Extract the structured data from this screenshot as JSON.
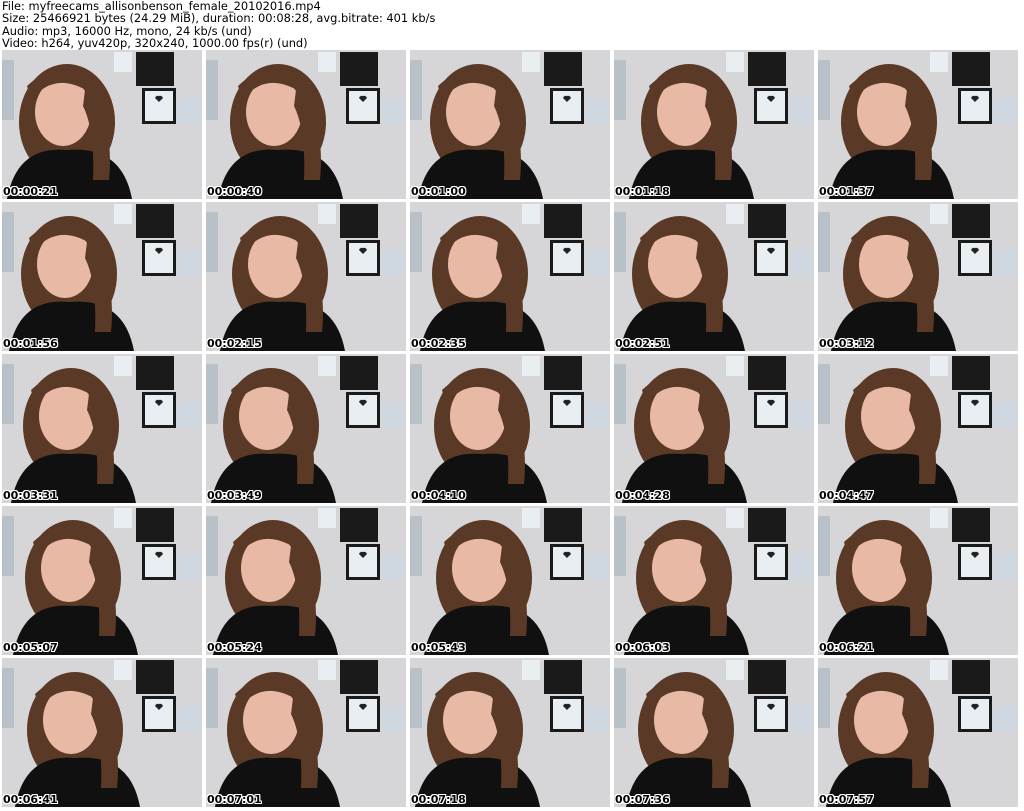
{
  "header": {
    "file_line": "File: myfreecams_allisonbenson_female_20102016.mp4",
    "size_line": "Size: 25466921 bytes (24.29 MiB), duration: 00:08:28, avg.bitrate: 401 kb/s",
    "audio_line": "Audio: mp3, 16000 Hz, mono, 24 kb/s (und)",
    "video_line": "Video: h264, yuv420p, 320x240, 1000.00 fps(r) (und)"
  },
  "thumbnails": [
    {
      "timestamp": "00:00:21"
    },
    {
      "timestamp": "00:00:40"
    },
    {
      "timestamp": "00:01:00"
    },
    {
      "timestamp": "00:01:18"
    },
    {
      "timestamp": "00:01:37"
    },
    {
      "timestamp": "00:01:56"
    },
    {
      "timestamp": "00:02:15"
    },
    {
      "timestamp": "00:02:35"
    },
    {
      "timestamp": "00:02:51"
    },
    {
      "timestamp": "00:03:12"
    },
    {
      "timestamp": "00:03:31"
    },
    {
      "timestamp": "00:03:49"
    },
    {
      "timestamp": "00:04:10"
    },
    {
      "timestamp": "00:04:28"
    },
    {
      "timestamp": "00:04:47"
    },
    {
      "timestamp": "00:05:07"
    },
    {
      "timestamp": "00:05:24"
    },
    {
      "timestamp": "00:05:43"
    },
    {
      "timestamp": "00:06:03"
    },
    {
      "timestamp": "00:06:21"
    },
    {
      "timestamp": "00:06:41"
    },
    {
      "timestamp": "00:07:01"
    },
    {
      "timestamp": "00:07:18"
    },
    {
      "timestamp": "00:07:36"
    },
    {
      "timestamp": "00:07:57"
    }
  ],
  "colors": {
    "wall": "#d6d6d8",
    "hair": "#5a3a26",
    "skin": "#e8b9a4",
    "sweater": "#101010",
    "frame_dark": "#1a1a1a",
    "poster_light": "#e9eef2",
    "timestamp_text": "#000000"
  }
}
